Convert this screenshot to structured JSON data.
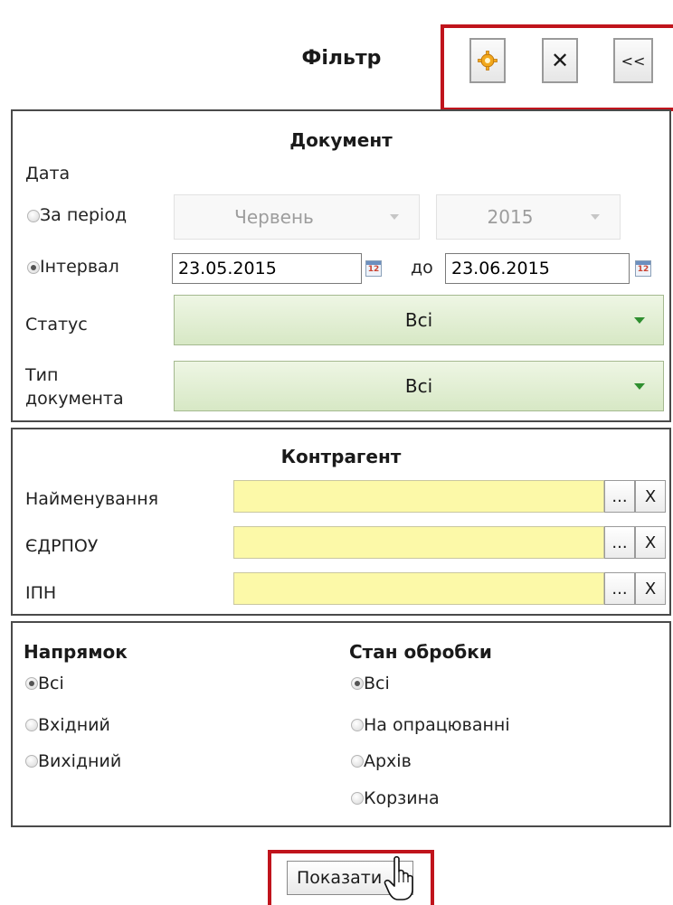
{
  "header": {
    "title": "Фільтр",
    "settings_icon": "gear-icon",
    "close_label": "✕",
    "collapse_label": "<<"
  },
  "document": {
    "title": "Документ",
    "date_label": "Дата",
    "period_label": "За період",
    "period_month": "Червень",
    "period_year": "2015",
    "interval_label": "Інтервал",
    "date_from": "23.05.2015",
    "date_to_label": "до",
    "date_to": "23.06.2015",
    "status_label": "Статус",
    "status_value": "Всі",
    "doctype_label_1": "Тип",
    "doctype_label_2": "документа",
    "doctype_value": "Всі"
  },
  "counterparty": {
    "title": "Контрагент",
    "name_label": "Найменування",
    "edrpou_label": "ЄДРПОУ",
    "ipn_label": "ІПН",
    "browse_label": "...",
    "clear_label": "X"
  },
  "direction": {
    "title": "Напрямок",
    "options": [
      "Всі",
      "Вхідний",
      "Вихідний"
    ]
  },
  "processing": {
    "title": "Стан обробки",
    "options": [
      "Всі",
      "На опрацюванні",
      "Архів",
      "Корзина"
    ]
  },
  "show_button": "Показати",
  "colors": {
    "highlight": "#c0141c",
    "green_select": "#d7e8c5",
    "yellow_input": "#fcf9a8"
  }
}
